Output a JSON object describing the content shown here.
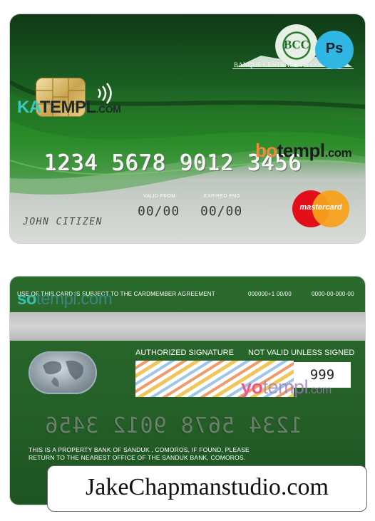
{
  "front": {
    "watermark_katempl": {
      "ka": "KA",
      "templ": "TEMPL",
      "com": ".COM"
    },
    "bank_monogram": "BCC",
    "bank_name": "BANQUE CENTRALE des COMORES",
    "ps_badge": "Ps",
    "card_number": "1234  5678  9012  3456",
    "watermark_botempl": {
      "bo": "bo",
      "templ": "templ",
      "com": ".com"
    },
    "valid_from_label": "VALID FROM",
    "expired_end_label": "EXPIRED END",
    "valid_from_value": "00/00",
    "expired_end_value": "00/00",
    "cardholder": "JOHN CITIZEN",
    "network_logo_text": "mastercard",
    "colors": {
      "green_dark": "#0f3a16",
      "green_light": "#2f8a2c",
      "silver": "#d9dcd8"
    }
  },
  "back": {
    "agreement_text": "USE OF THIS CARD IS SUBJECT TO THE CARDMEMBER AGREEMENT",
    "phone_1": "000000+1 00/00",
    "phone_2": "0000-00-000-00",
    "watermark_sotempl": {
      "so": "so",
      "templ": "templ.com"
    },
    "authorized_signature": "AUTHORIZED SIGNATURE",
    "not_valid": "NOT VALID UNLESS SIGNED",
    "cvv": "999",
    "watermark_yotempl": {
      "yo": "yo",
      "templ": "templ",
      "com": ".com"
    },
    "mirrored_number": "1234  5678  9012  3456",
    "property_line_1": "THIS IS A PROPERTY BANK OF SANDUK , COMOROS,  IF FOUND, PLEASE",
    "property_line_2": "RETURN TO THE NEAREST OFFICE OF THE SANDUK BANK, COMOROS.",
    "colors": {
      "green": "#245f27",
      "stripe": "#c8c8c8"
    }
  },
  "credit": "JakeChapmanstudio.com"
}
